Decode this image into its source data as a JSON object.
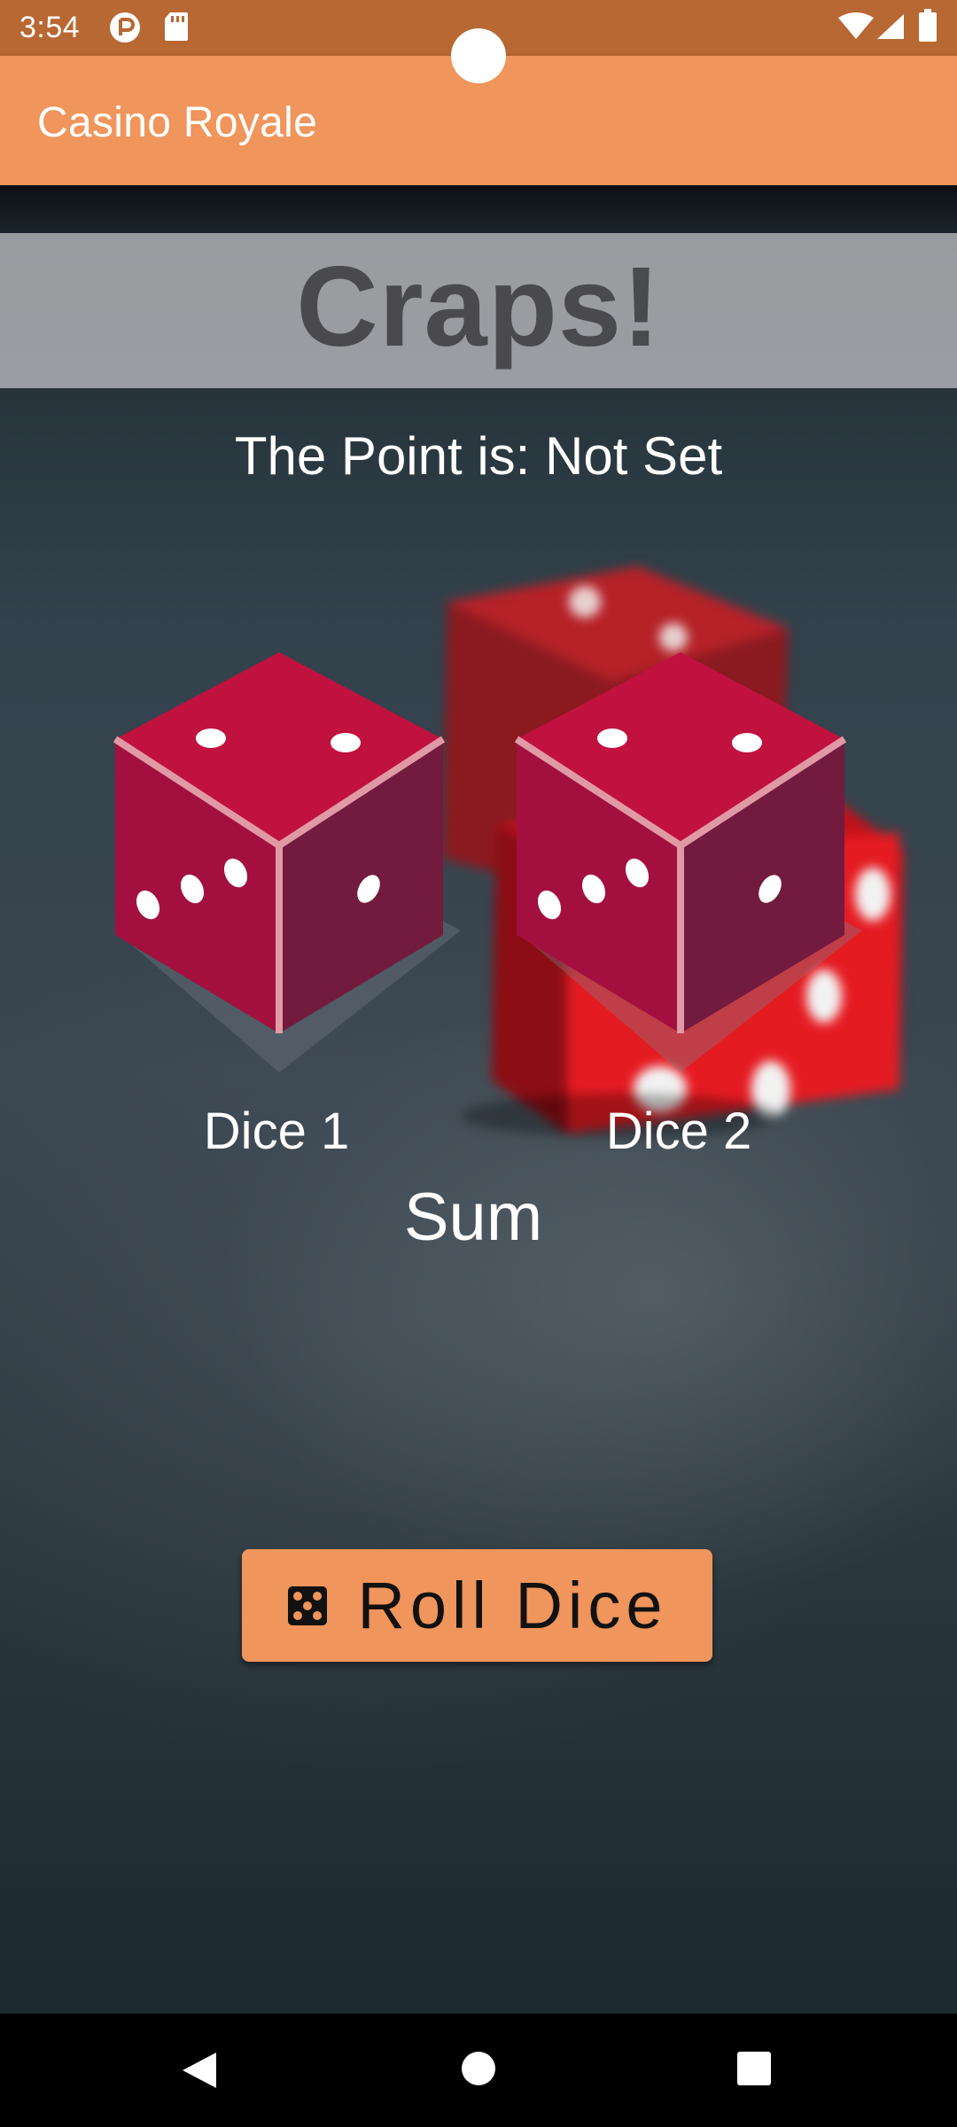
{
  "status_bar": {
    "time": "3:54",
    "icons": [
      "data-saver-icon",
      "sd-card-icon",
      "wifi-icon",
      "signal-icon",
      "battery-icon"
    ]
  },
  "app_bar": {
    "title": "Casino Royale"
  },
  "game": {
    "title": "Craps!",
    "point_text": "The Point is: Not Set",
    "dice": [
      {
        "label": "Dice 1"
      },
      {
        "label": "Dice 2"
      }
    ],
    "sum_label": "Sum",
    "roll_button_label": "Roll Dice"
  },
  "colors": {
    "status_bar": "#b86832",
    "app_bar": "#f0955b",
    "die_top": "#c0113f",
    "die_left": "#a3103f",
    "die_right": "#731a3f",
    "die_edge": "#e09aa6",
    "title_text": "#4a4a4c"
  },
  "nav_bar": {
    "buttons": [
      "back-icon",
      "home-icon",
      "recents-icon"
    ]
  }
}
